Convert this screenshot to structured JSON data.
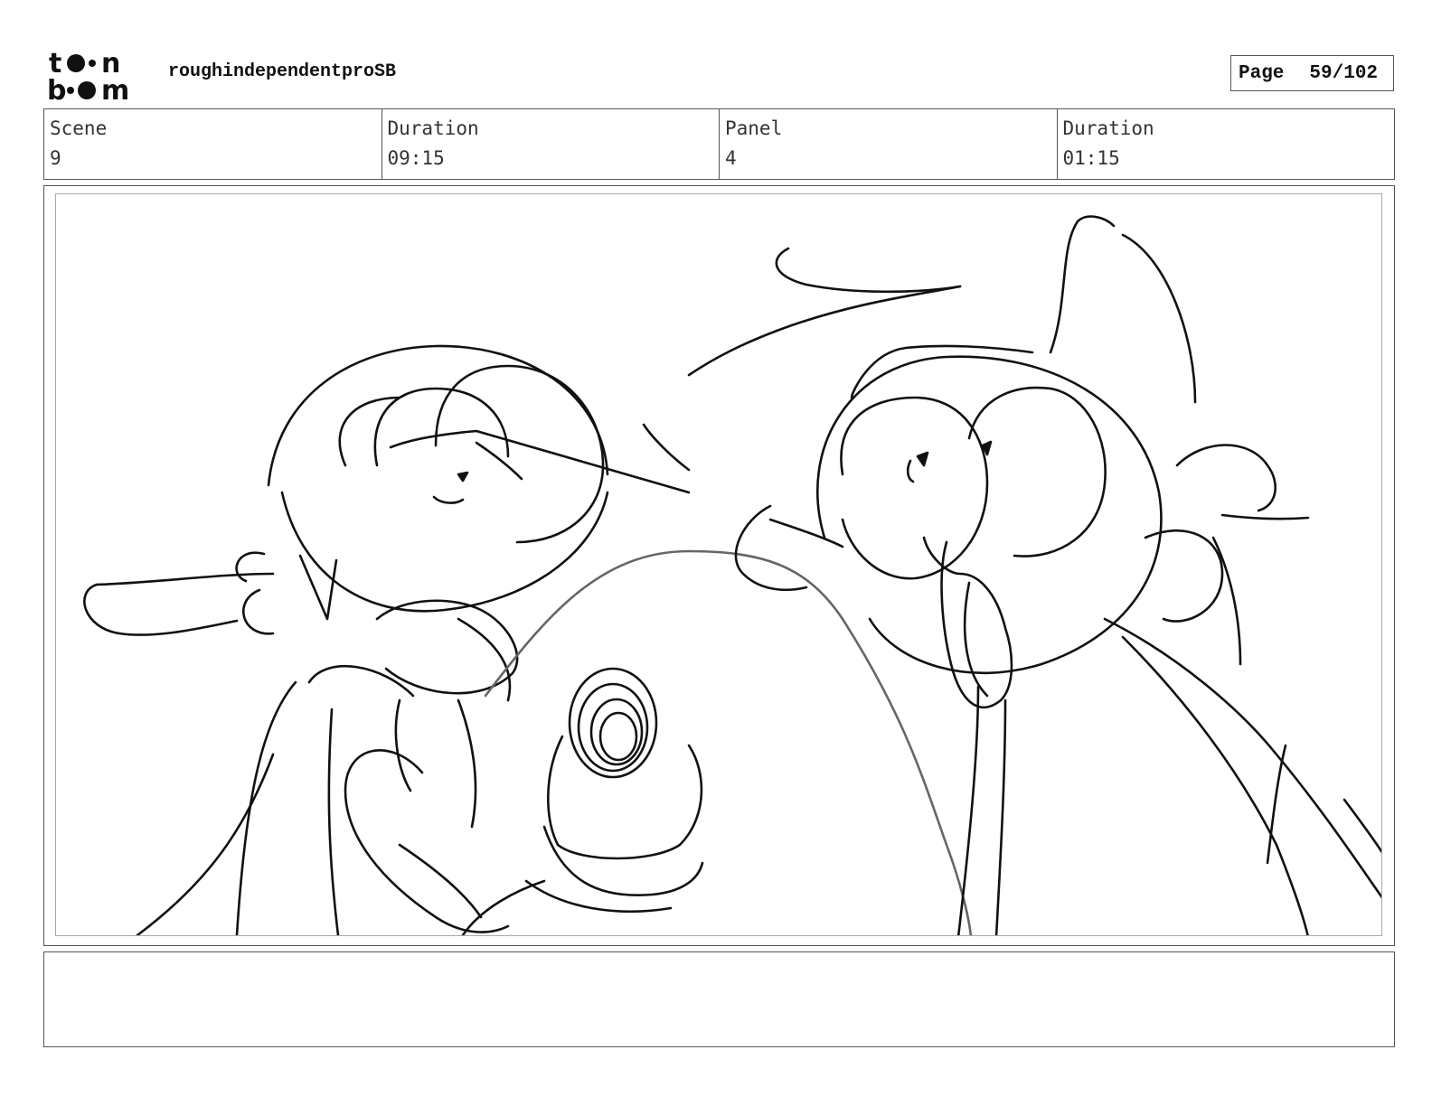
{
  "header": {
    "logo_text": "toon boom",
    "project_title": "roughindependentproSB",
    "page_label": "Page",
    "page_number": "59/102"
  },
  "info": {
    "scene_label": "Scene",
    "scene_value": "9",
    "scene_duration_label": "Duration",
    "scene_duration_value": "09:15",
    "panel_label": "Panel",
    "panel_value": "4",
    "panel_duration_label": "Duration",
    "panel_duration_value": "01:15"
  },
  "panel": {
    "image_kind": "rough storyboard sketch"
  },
  "notes": {
    "text": ""
  }
}
